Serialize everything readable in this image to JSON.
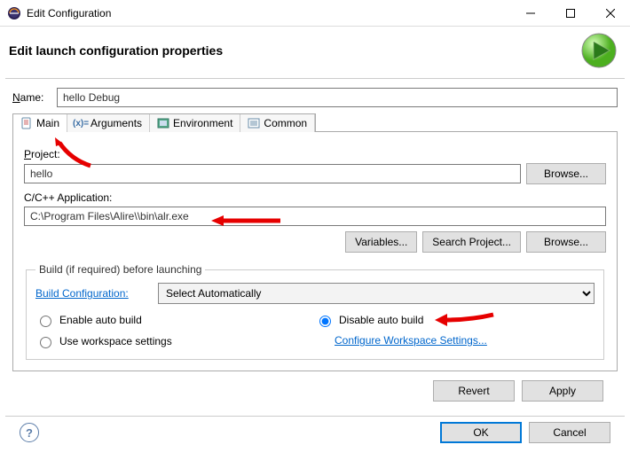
{
  "window": {
    "title": "Edit Configuration"
  },
  "header": {
    "title": "Edit launch configuration properties"
  },
  "name": {
    "label": "Name:",
    "value": "hello Debug"
  },
  "tabs": {
    "main": "Main",
    "arguments": "Arguments",
    "environment": "Environment",
    "common": "Common"
  },
  "main": {
    "project_label": "Project:",
    "project_value": "hello",
    "browse1": "Browse...",
    "app_label": "C/C++ Application:",
    "app_value": "C:\\Program Files\\Alire\\\\bin\\alr.exe",
    "variables": "Variables...",
    "search_project": "Search Project...",
    "browse2": "Browse...",
    "build_group": "Build (if required) before launching",
    "build_config_label": "Build Configuration:",
    "build_config_value": "Select Automatically",
    "radio_enable": "Enable auto build",
    "radio_disable": "Disable auto build",
    "radio_workspace": "Use workspace settings",
    "configure_link": "Configure Workspace Settings..."
  },
  "buttons": {
    "revert": "Revert",
    "apply": "Apply",
    "ok": "OK",
    "cancel": "Cancel"
  }
}
